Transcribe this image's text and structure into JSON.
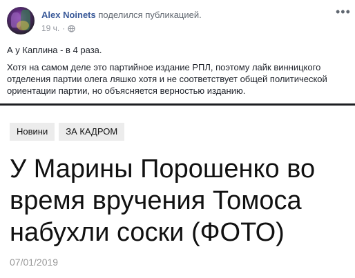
{
  "post": {
    "author": "Alex Noinets",
    "action": "поделился публикацией.",
    "time": "19 ч.",
    "separator": "·",
    "privacy_icon": "globe-icon",
    "more_icon": "more-dots-icon",
    "more_label": "•••",
    "text": [
      "А у Каплина - в 4 раза.",
      "Хотя на самом деле это партийное издание РПЛ, поэтому лайк винницкого отделения партии олега ляшко хотя и не соответствует общей политической ориентации партии, но объясняется верностью изданию."
    ]
  },
  "article": {
    "tags": [
      "Новини",
      "ЗА КАДРОМ"
    ],
    "headline": "У Марины Порошенко во время вручения Томоса набухли соски (ФОТО)",
    "date": "07/01/2019"
  },
  "colors": {
    "author": "#385898",
    "meta": "#90949c",
    "tag_bg": "#ececec",
    "date": "#999999"
  }
}
